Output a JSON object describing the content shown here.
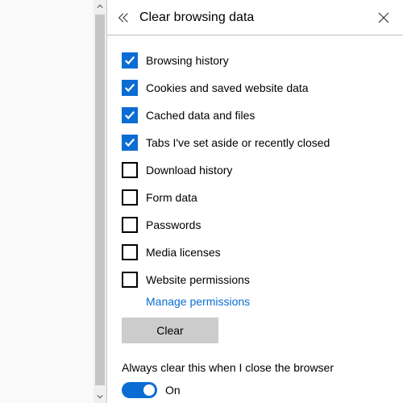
{
  "header": {
    "title": "Clear browsing data"
  },
  "items": [
    {
      "label": "Browsing history",
      "checked": true
    },
    {
      "label": "Cookies and saved website data",
      "checked": true
    },
    {
      "label": "Cached data and files",
      "checked": true
    },
    {
      "label": "Tabs I've set aside or recently closed",
      "checked": true
    },
    {
      "label": "Download history",
      "checked": false
    },
    {
      "label": "Form data",
      "checked": false
    },
    {
      "label": "Passwords",
      "checked": false
    },
    {
      "label": "Media licenses",
      "checked": false
    },
    {
      "label": "Website permissions",
      "checked": false
    }
  ],
  "manage_link": "Manage permissions",
  "clear_button": "Clear",
  "always_clear": {
    "label": "Always clear this when I close the browser",
    "state_label": "On",
    "enabled": true
  }
}
